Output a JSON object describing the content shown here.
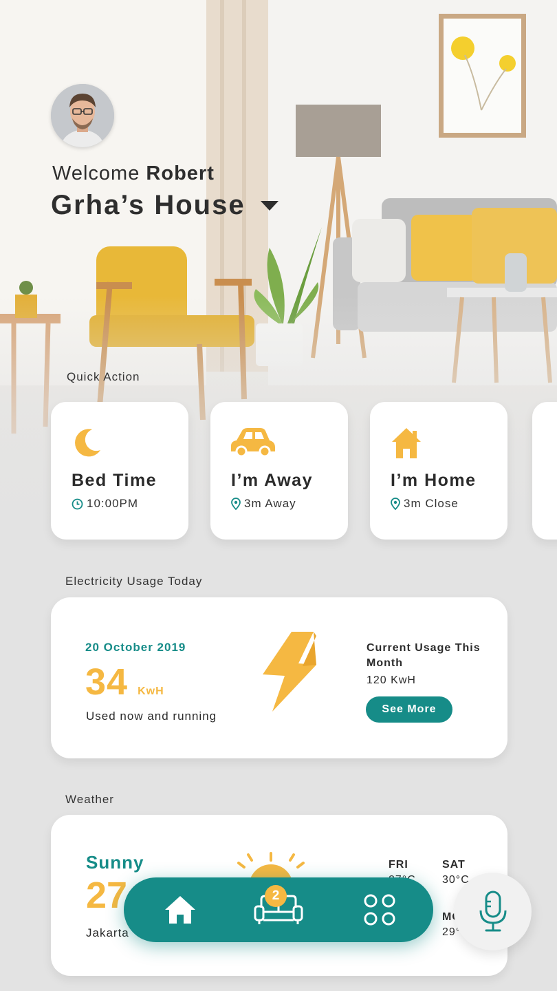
{
  "header": {
    "welcome_prefix": "Welcome",
    "user_name": "Robert",
    "house_name": "Grha’s House"
  },
  "quick_action": {
    "title": "Quick Action",
    "items": [
      {
        "label": "Bed Time",
        "meta": "10:00PM",
        "icon": "moon-icon",
        "meta_icon": "clock-icon"
      },
      {
        "label": "I’m Away",
        "meta": "3m Away",
        "icon": "car-icon",
        "meta_icon": "location-pin-icon"
      },
      {
        "label": "I’m Home",
        "meta": "3m Close",
        "icon": "house-icon",
        "meta_icon": "location-pin-icon"
      }
    ]
  },
  "electricity": {
    "title": "Electricity Usage Today",
    "date": "20 October 2019",
    "value": "34",
    "unit": "KwH",
    "status": "Used now and running",
    "current_title": "Current Usage This Month",
    "current_value": "120 KwH",
    "see_more": "See More"
  },
  "weather": {
    "title": "Weather",
    "condition": "Sunny",
    "temp": "27",
    "city": "Jakarta",
    "forecast": [
      {
        "day": "FRI",
        "temp": "27°C"
      },
      {
        "day": "SAT",
        "temp": "30°C"
      },
      {
        "day": "MON",
        "temp": "29°C"
      }
    ]
  },
  "nav": {
    "badge": "2",
    "items": [
      "home-icon",
      "sofa-icon",
      "apps-grid-icon"
    ]
  },
  "colors": {
    "accent": "#168c88",
    "highlight": "#f5b842",
    "background": "#e3e3e3"
  }
}
